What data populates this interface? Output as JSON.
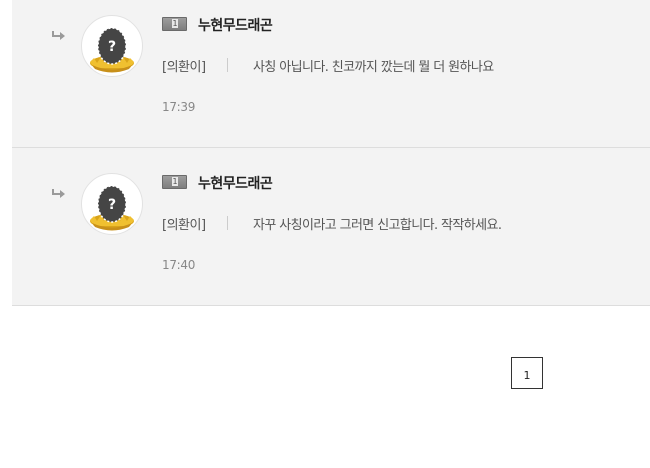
{
  "comments": [
    {
      "level": "1",
      "author": "누현무드래곤",
      "target": "[의환이]",
      "message": "사칭 아닙니다. 친코까지 깠는데 뭘 더 원하나요",
      "time": "17:39"
    },
    {
      "level": "1",
      "author": "누현무드래곤",
      "target": "[의환이]",
      "message": "자꾸 사칭이라고 그러면 신고합니다. 작작하세요.",
      "time": "17:40"
    }
  ],
  "pagination": {
    "current_page": "1"
  },
  "icons": {
    "reply": "reply-arrow-icon",
    "avatar": "egg-nest-avatar-icon",
    "level": "level-badge-icon"
  }
}
